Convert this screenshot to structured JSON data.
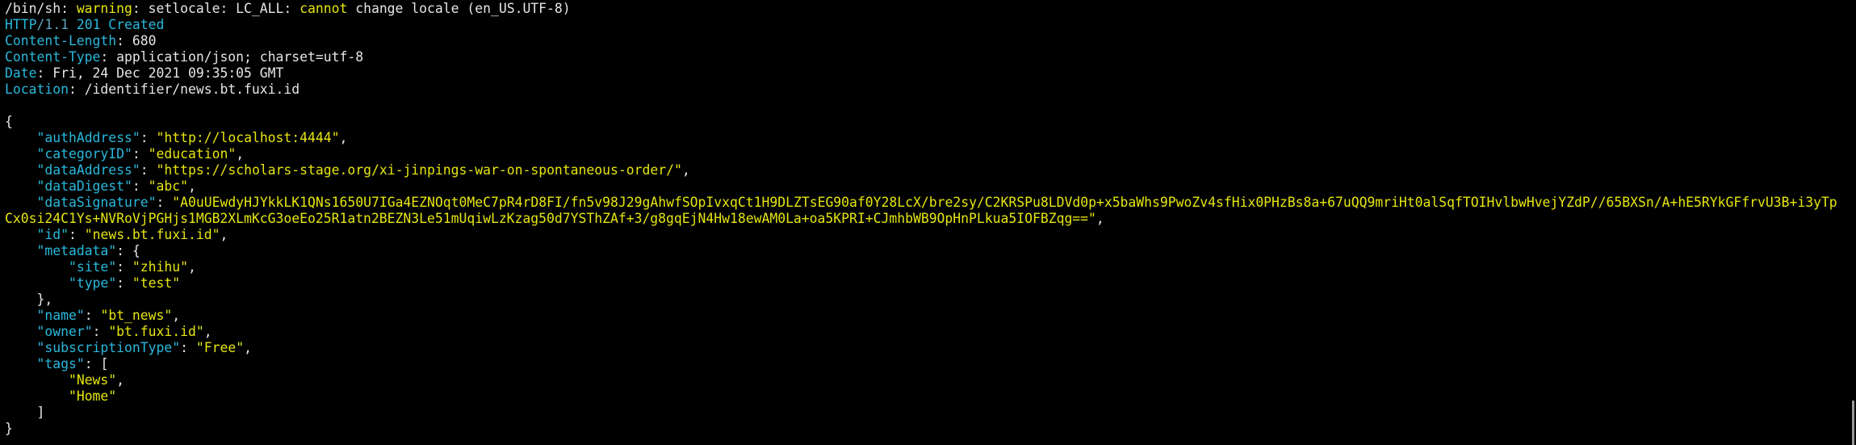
{
  "terminal": {
    "warning": {
      "prefix": "/bin/sh: ",
      "label": "warning",
      "middle": ": setlocale: LC_ALL: ",
      "emphasis": "cannot",
      "rest": " change locale (en_US.UTF-8)"
    },
    "status": {
      "proto": "HTTP",
      "version": "/1.1",
      "code": " 201 Created"
    },
    "headers": [
      {
        "name": "Content-Length",
        "value": ": 680"
      },
      {
        "name": "Content-Type",
        "value": ": application/json; charset=utf-8"
      },
      {
        "name": "Date",
        "value": ": Fri, 24 Dec 2021 09:35:05 GMT"
      },
      {
        "name": "Location",
        "value": ": /identifier/news.bt.fuxi.id"
      }
    ],
    "body": {
      "open_brace": "{",
      "authAddress": {
        "indent": "    ",
        "key": "\"authAddress\"",
        "sep": ": ",
        "value": "\"http://localhost:4444\"",
        "end": ","
      },
      "categoryID": {
        "indent": "    ",
        "key": "\"categoryID\"",
        "sep": ": ",
        "value": "\"education\"",
        "end": ","
      },
      "dataAddress": {
        "indent": "    ",
        "key": "\"dataAddress\"",
        "sep": ": ",
        "value": "\"https://scholars-stage.org/xi-jinpings-war-on-spontaneous-order/\"",
        "end": ","
      },
      "dataDigest": {
        "indent": "    ",
        "key": "\"dataDigest\"",
        "sep": ": ",
        "value": "\"abc\"",
        "end": ","
      },
      "dataSignature": {
        "indent": "    ",
        "key": "\"dataSignature\"",
        "sep": ": ",
        "value": "\"A0uUEwdyHJYkkLK1QNs1650U7IGa4EZNOqt0MeC7pR4rD8FI/fn5v98J29gAhwfSOpIvxqCt1H9DLZTsEG90af0Y28LcX/bre2sy/C2KRSPu8LDVd0p+x5baWhs9PwoZv4sfHix0PHzBs8a+67uQQ9mriHt0alSqfTOIHvlbwHvejYZdP//65BXSn/A+hE5RYkGFfrvU3B+i3yTpCx0si24C1Ys+NVRoVjPGHjs1MGB2XLmKcG3oeEo25R1atn2BEZN3Le51mUqiwLzKzag50d7YSThZAf+3/g8gqEjN4Hw18ewAM0La+oa5KPRI+CJmhbWB9OpHnPLkua5IOFBZqg==\"",
        "end": ","
      },
      "id": {
        "indent": "    ",
        "key": "\"id\"",
        "sep": ": ",
        "value": "\"news.bt.fuxi.id\"",
        "end": ","
      },
      "metadata_open": {
        "indent": "    ",
        "key": "\"metadata\"",
        "sep": ": ",
        "brace": "{"
      },
      "metadata_site": {
        "indent": "        ",
        "key": "\"site\"",
        "sep": ": ",
        "value": "\"zhihu\"",
        "end": ","
      },
      "metadata_type": {
        "indent": "        ",
        "key": "\"type\"",
        "sep": ": ",
        "value": "\"test\"",
        "end": ""
      },
      "metadata_close": "    },",
      "name": {
        "indent": "    ",
        "key": "\"name\"",
        "sep": ": ",
        "value": "\"bt_news\"",
        "end": ","
      },
      "owner": {
        "indent": "    ",
        "key": "\"owner\"",
        "sep": ": ",
        "value": "\"bt.fuxi.id\"",
        "end": ","
      },
      "subscriptionType": {
        "indent": "    ",
        "key": "\"subscriptionType\"",
        "sep": ": ",
        "value": "\"Free\"",
        "end": ","
      },
      "tags_open": {
        "indent": "    ",
        "key": "\"tags\"",
        "sep": ": ",
        "bracket": "["
      },
      "tags": [
        {
          "indent": "        ",
          "value": "\"News\"",
          "end": ","
        },
        {
          "indent": "        ",
          "value": "\"Home\"",
          "end": ""
        }
      ],
      "tags_close": "    ]",
      "close_brace": "}"
    },
    "colors": {
      "background": "#000000",
      "text": "#e5e5e5",
      "cyan": "#29b8db",
      "yellow": "#e5e510"
    }
  }
}
